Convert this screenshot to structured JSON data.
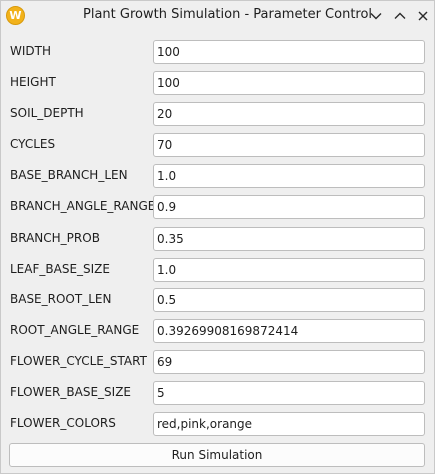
{
  "window": {
    "title": "Plant Growth Simulation - Parameter Control",
    "app_icon_letter": "W",
    "controls": [
      "chevron-down-icon",
      "chevron-up-icon",
      "close-icon"
    ]
  },
  "params": [
    {
      "label": "WIDTH",
      "value": "100"
    },
    {
      "label": "HEIGHT",
      "value": "100"
    },
    {
      "label": "SOIL_DEPTH",
      "value": "20"
    },
    {
      "label": "CYCLES",
      "value": "70"
    },
    {
      "label": "BASE_BRANCH_LEN",
      "value": "1.0"
    },
    {
      "label": "BRANCH_ANGLE_RANGE",
      "value": "0.9"
    },
    {
      "label": "BRANCH_PROB",
      "value": "0.35"
    },
    {
      "label": "LEAF_BASE_SIZE",
      "value": "1.0"
    },
    {
      "label": "BASE_ROOT_LEN",
      "value": "0.5"
    },
    {
      "label": "ROOT_ANGLE_RANGE",
      "value": "0.39269908169872414"
    },
    {
      "label": "FLOWER_CYCLE_START",
      "value": "69"
    },
    {
      "label": "FLOWER_BASE_SIZE",
      "value": "5"
    },
    {
      "label": "FLOWER_COLORS",
      "value": "red,pink,orange"
    }
  ],
  "run_button": {
    "label": "Run Simulation"
  },
  "colors": {
    "app_icon": "#f2b21a",
    "background": "#efefef",
    "field_border": "#bdbdbd"
  }
}
